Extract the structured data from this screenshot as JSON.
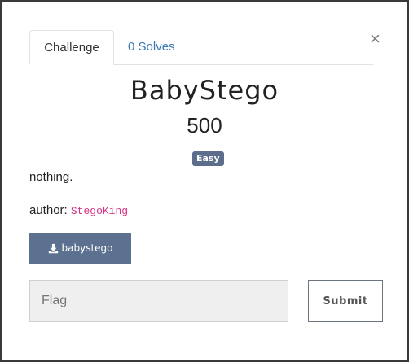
{
  "tabs": {
    "challenge_label": "Challenge",
    "solves_label": "0 Solves"
  },
  "close_symbol": "×",
  "challenge": {
    "name": "BabyStego",
    "value": "500",
    "difficulty": "Easy",
    "description": "nothing.",
    "author_label": "author:",
    "author_name": "StegoKing"
  },
  "download": {
    "icon": "download-icon",
    "label": "babystego"
  },
  "form": {
    "flag_placeholder": "Flag",
    "flag_value": "",
    "submit_label": "Submit"
  },
  "colors": {
    "badge": "#5c6e8c",
    "download_button": "#5c7190",
    "tab_link": "#3a78b5",
    "author_code": "#d63384"
  }
}
